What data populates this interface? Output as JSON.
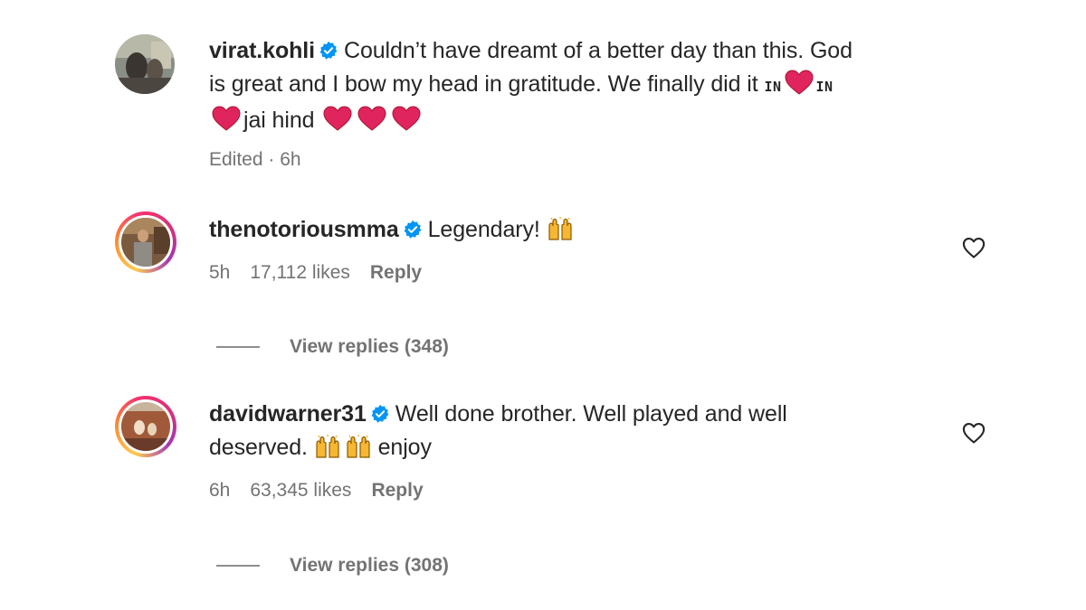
{
  "comments": [
    {
      "username": "virat.kohli",
      "verified": true,
      "text_line1": "Couldn’t have dreamt of a better day than this. God",
      "text_line2": "is great and I bow my head in gratitude. We finally did it",
      "flag_code": "IN",
      "text_line3": "jai hind",
      "timestamp": "Edited · 6h",
      "emojis": [
        "flag-india",
        "red-heart",
        "flag-india",
        "red-heart",
        "red-heart",
        "red-heart",
        "red-heart"
      ]
    },
    {
      "username": "thenotoriousmma",
      "verified": true,
      "text": "Legendary!",
      "emojis": [
        "raising-hands"
      ],
      "time": "5h",
      "likes": "17,112 likes",
      "reply_label": "Reply",
      "view_replies": "View replies (348)"
    },
    {
      "username": "davidwarner31",
      "verified": true,
      "text_line1": "Well done brother. Well played and well",
      "text_line2": "deserved.",
      "text_end": "enjoy",
      "emojis": [
        "raising-hands",
        "raising-hands"
      ],
      "time": "6h",
      "likes": "63,345 likes",
      "reply_label": "Reply",
      "view_replies": "View replies (308)"
    }
  ],
  "colors": {
    "text": "#262626",
    "secondary": "#737373",
    "verified": "#0095f6",
    "heart": "#e0245e"
  },
  "icons": {
    "verified": "verified-badge-icon",
    "like": "heart-outline-icon"
  }
}
